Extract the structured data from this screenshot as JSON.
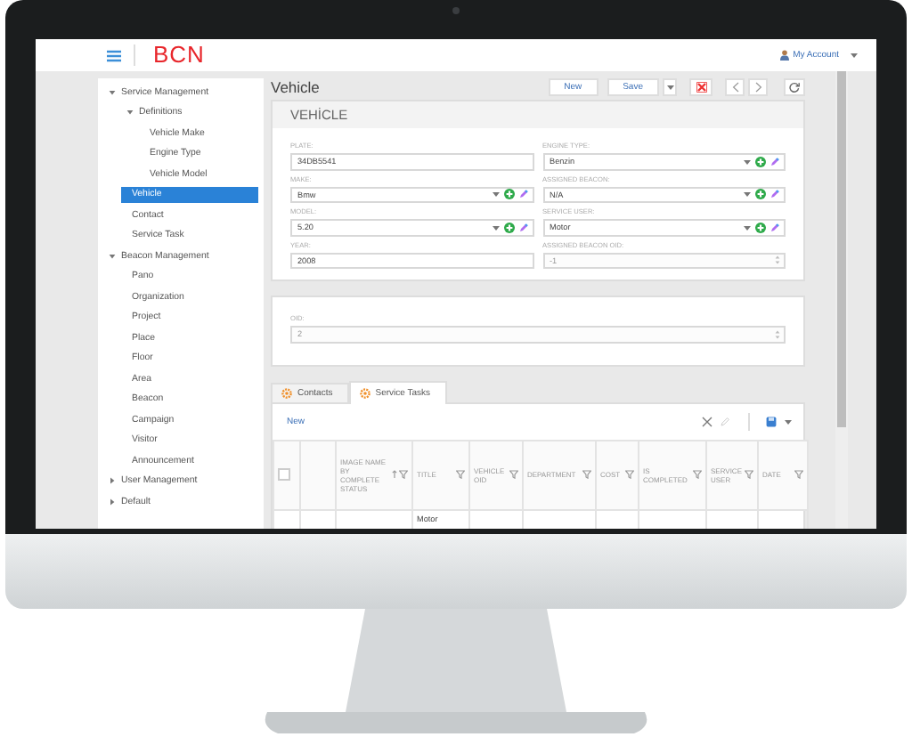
{
  "header": {
    "logo": "BCN",
    "account": "My Account"
  },
  "sidebar": {
    "items": [
      {
        "label": "Service Management",
        "expanded": true,
        "selected": false,
        "children": [
          {
            "label": "Definitions",
            "expanded": true,
            "selected": false,
            "children": [
              {
                "label": "Vehicle Make",
                "selected": false
              },
              {
                "label": "Engine Type",
                "selected": false
              },
              {
                "label": "Vehicle Model",
                "selected": false
              }
            ]
          },
          {
            "label": "Vehicle",
            "selected": true
          },
          {
            "label": "Contact",
            "selected": false
          },
          {
            "label": "Service Task",
            "selected": false
          }
        ]
      },
      {
        "label": "Beacon Management",
        "expanded": true,
        "selected": false,
        "children": [
          {
            "label": "Pano",
            "selected": false
          },
          {
            "label": "Organization",
            "selected": false
          },
          {
            "label": "Project",
            "selected": false
          },
          {
            "label": "Place",
            "selected": false
          },
          {
            "label": "Floor",
            "selected": false
          },
          {
            "label": "Area",
            "selected": false
          },
          {
            "label": "Beacon",
            "selected": false
          },
          {
            "label": "Campaign",
            "selected": false
          },
          {
            "label": "Visitor",
            "selected": false
          },
          {
            "label": "Announcement",
            "selected": false
          }
        ]
      },
      {
        "label": "User Management",
        "expanded": false,
        "selected": false
      },
      {
        "label": "Default",
        "expanded": false,
        "selected": false
      }
    ]
  },
  "page": {
    "title": "Vehicle",
    "toolbar": [
      {
        "kind": "text",
        "label": "New"
      },
      {
        "kind": "text",
        "label": "Save"
      },
      {
        "kind": "caret"
      },
      {
        "kind": "delete"
      },
      {
        "kind": "prev"
      },
      {
        "kind": "next"
      },
      {
        "kind": "refresh"
      }
    ]
  },
  "vehicle_card": {
    "title": "VEHİCLE",
    "columns": [
      {
        "fields": [
          {
            "label": "PLATE:",
            "value": "34DB5541",
            "kind": "text",
            "disabled": false
          },
          {
            "label": "MAKE:",
            "value": "Bmw",
            "kind": "select",
            "disabled": false
          },
          {
            "label": "MODEL:",
            "value": "5.20",
            "kind": "select",
            "disabled": false
          },
          {
            "label": "YEAR:",
            "value": "2008",
            "kind": "text",
            "disabled": false
          }
        ]
      },
      {
        "fields": [
          {
            "label": "ENGINE TYPE:",
            "value": "Benzin",
            "kind": "select",
            "disabled": false
          },
          {
            "label": "ASSIGNED BEACON:",
            "value": "N/A",
            "kind": "select",
            "disabled": false
          },
          {
            "label": "SERVICE USER:",
            "value": "Motor",
            "kind": "select",
            "disabled": false
          },
          {
            "label": "ASSIGNED BEACON OID:",
            "value": "-1",
            "kind": "number",
            "disabled": true
          }
        ]
      }
    ]
  },
  "oid_card": {
    "fields": [
      {
        "label": "OID:",
        "value": "2",
        "kind": "number",
        "disabled": true
      }
    ]
  },
  "detail": {
    "tabs": [
      {
        "label": "Contacts",
        "selected": false
      },
      {
        "label": "Service Tasks",
        "selected": true
      }
    ],
    "new_link": "New",
    "table": {
      "select_all": {
        "checked": false
      },
      "columns": [
        {
          "kind": "checkbox"
        },
        {
          "kind": "blank"
        },
        {
          "kind": "data",
          "label": "IMAGE NAME BY COMPLETE STATUS",
          "sort": true,
          "filter": true
        },
        {
          "kind": "data",
          "label": "TITLE",
          "filter": true
        },
        {
          "kind": "data",
          "label": "VEHICLE OID",
          "filter": true
        },
        {
          "kind": "data",
          "label": "DEPARTMENT",
          "filter": true
        },
        {
          "kind": "data",
          "label": "COST",
          "filter": true
        },
        {
          "kind": "data",
          "label": "IS COMPLETED",
          "filter": true
        },
        {
          "kind": "data",
          "label": "SERVICE USER",
          "filter": true
        },
        {
          "kind": "data",
          "label": "DATE",
          "filter": true
        }
      ],
      "rows": [
        {
          "cells": [
            null,
            null,
            null,
            "Motor",
            null,
            null,
            null,
            null,
            null,
            null
          ]
        }
      ]
    }
  }
}
